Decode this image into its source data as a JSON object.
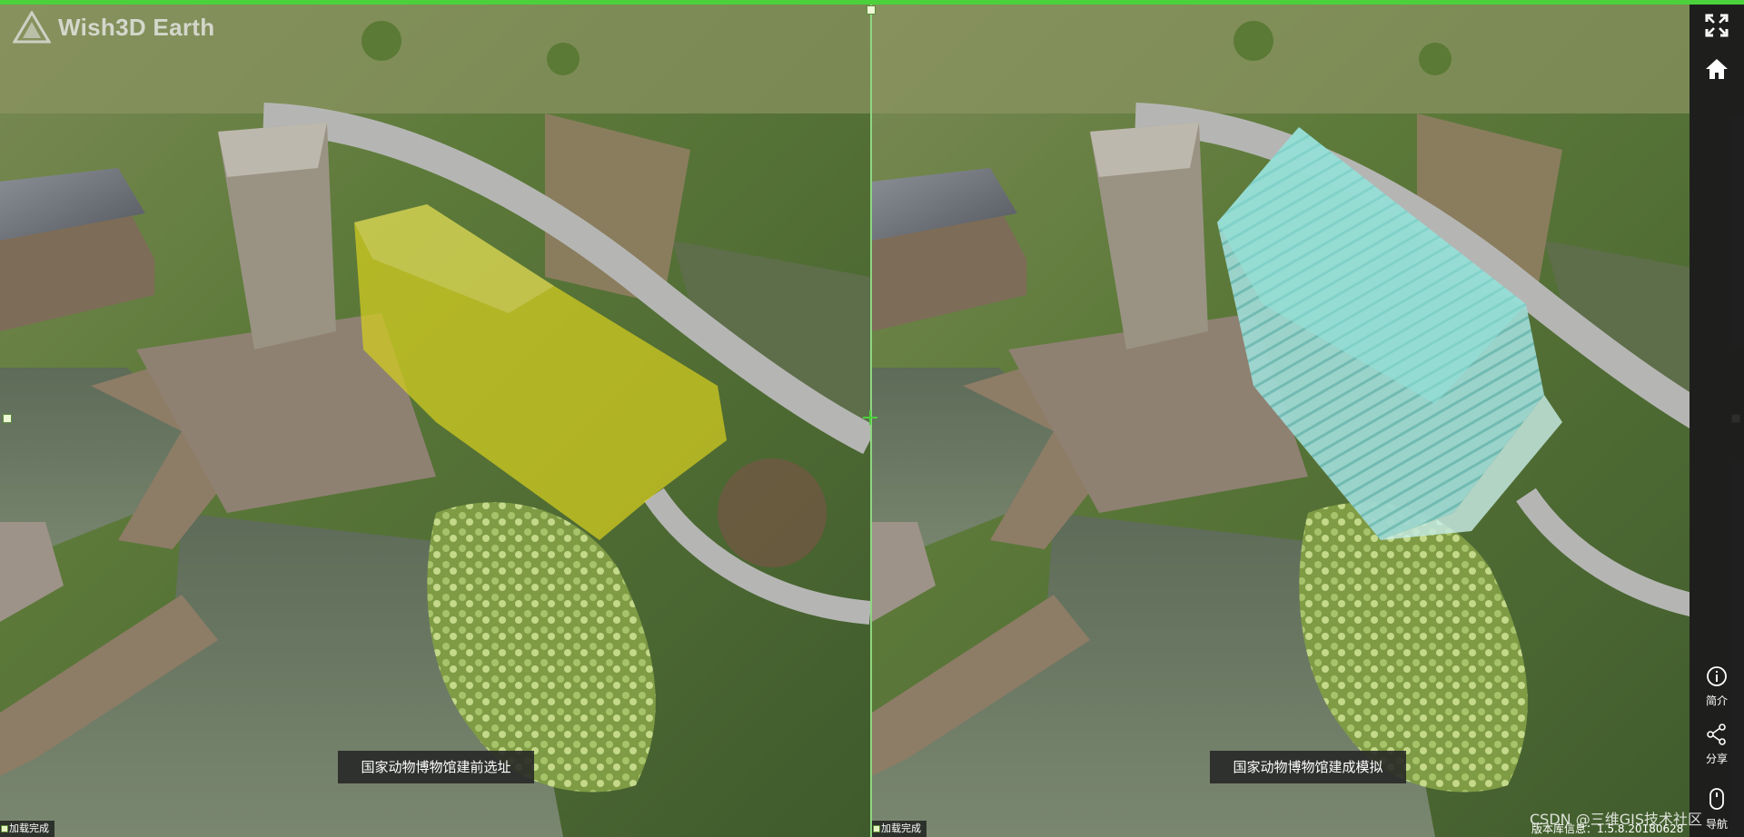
{
  "app": {
    "logo_text": "Wish3D Earth"
  },
  "panels": [
    {
      "caption": "国家动物博物馆建前选址",
      "status": "加载完成",
      "highlight_color": "#d6cf1e"
    },
    {
      "caption": "国家动物博物馆建成模拟",
      "status": "加载完成",
      "highlight_color": "#8fe3da"
    }
  ],
  "toolbar": {
    "fullscreen_icon": "fullscreen-icon",
    "home_icon": "home-icon",
    "intro_label": "简介",
    "share_label": "分享",
    "mouse_label": "导航"
  },
  "footer": {
    "version_text": "版本库信息：1.5.8.20180628",
    "watermark": "CSDN @三维GIS技术社区"
  },
  "colors": {
    "accent": "#4ad13b",
    "toolbar_bg": "#1e1e1e"
  }
}
